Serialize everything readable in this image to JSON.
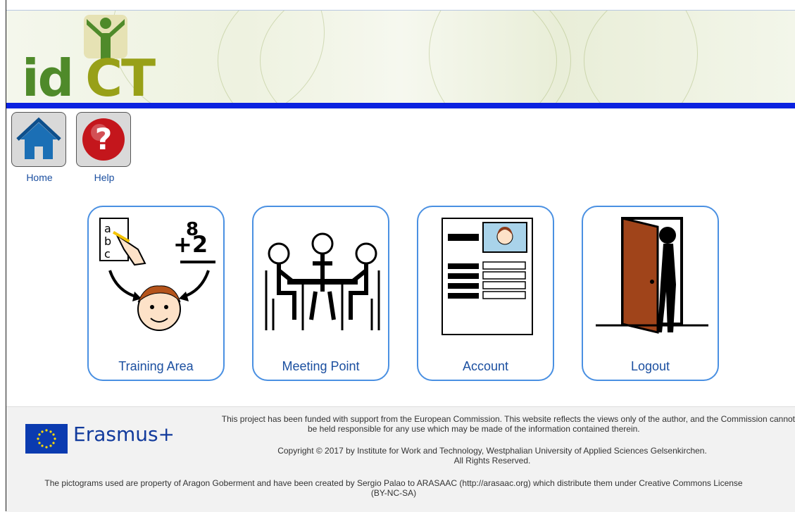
{
  "header": {
    "logo_text_a": "id",
    "logo_text_b": "CT"
  },
  "nav": [
    {
      "label": "Home",
      "icon": "home-icon"
    },
    {
      "label": "Help",
      "icon": "help-icon"
    }
  ],
  "tiles": [
    {
      "label": "Training Area",
      "icon": "training-area-icon"
    },
    {
      "label": "Meeting Point",
      "icon": "meeting-point-icon"
    },
    {
      "label": "Account",
      "icon": "account-icon"
    },
    {
      "label": "Logout",
      "icon": "logout-icon"
    }
  ],
  "footer": {
    "funding_line1": "This project has been funded with support from the European Commission. This website reflects the views only of the author, and the Commission cannot",
    "funding_line2": "be held responsible for any use which may be made of the information contained therein.",
    "copyright_line1": "Copyright © 2017 by Institute for Work and Technology, Westphalian University of Applied Sciences Gelsenkirchen.",
    "copyright_line2": "All Rights Reserved.",
    "pictograms_line1": "The pictograms used are property of Aragon Goberment and have been created by Sergio Palao to ARASAAC (http://arasaac.org) which distribute them under Creative Commons License",
    "pictograms_line2": "(BY-NC-SA)",
    "erasmus_label": "Erasmus+"
  },
  "colors": {
    "accent_blue": "#0b22e0",
    "tile_border": "#4a90e2",
    "link": "#1b4fa0"
  }
}
